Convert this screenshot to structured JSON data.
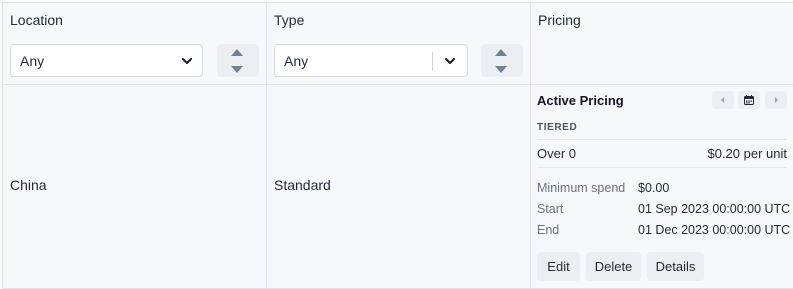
{
  "columns": {
    "location": "Location",
    "type": "Type",
    "pricing": "Pricing"
  },
  "filters": {
    "location_value": "Any",
    "type_value": "Any"
  },
  "row": {
    "location": "China",
    "type": "Standard"
  },
  "pricing": {
    "title": "Active Pricing",
    "tier_label": "TIERED",
    "tier_range": "Over 0",
    "tier_price": "$0.20 per unit",
    "min_spend_label": "Minimum spend",
    "min_spend_value": "$0.00",
    "start_label": "Start",
    "start_value": "01 Sep 2023 00:00:00 UTC",
    "end_label": "End",
    "end_value": "01 Dec 2023 00:00:00 UTC",
    "edit": "Edit",
    "delete": "Delete",
    "details": "Details"
  },
  "colors": {
    "border": "#dde3ea",
    "background": "#f6f8fa",
    "button": "#eceff2",
    "text": "#1f2937",
    "muted": "#6b7280"
  },
  "icons": [
    "chevron-down-icon",
    "sort-arrows-icon",
    "chevron-left-icon",
    "calendar-icon",
    "chevron-right-icon"
  ]
}
